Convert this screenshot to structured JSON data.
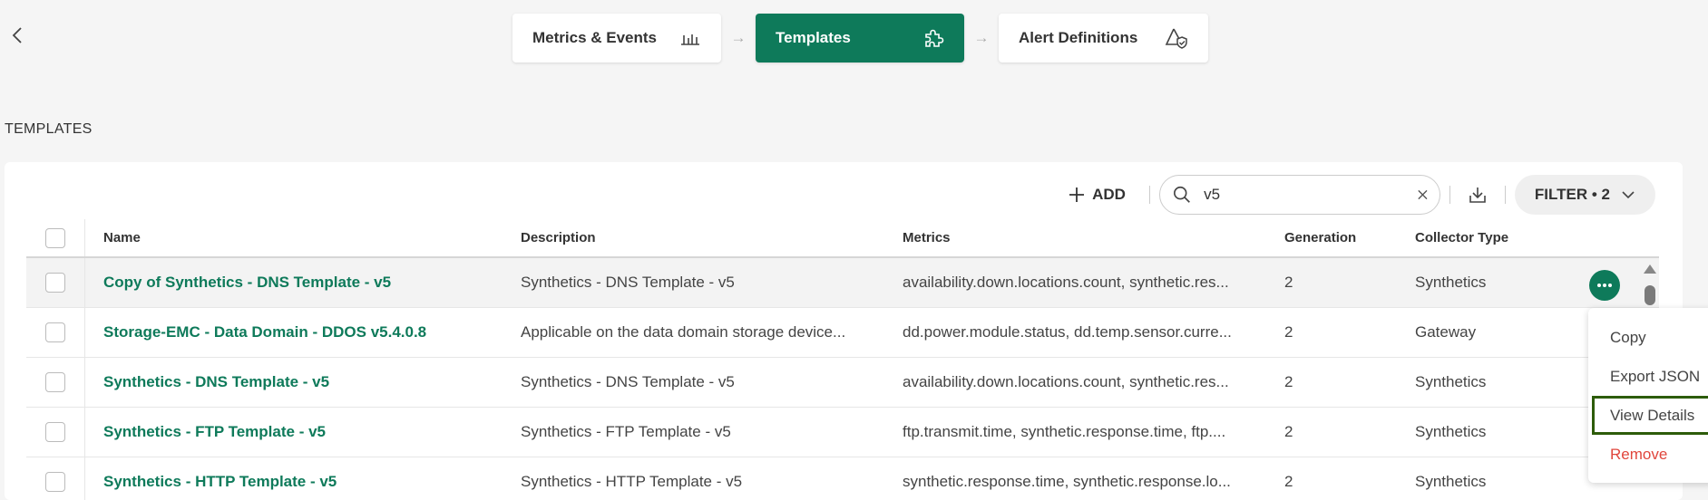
{
  "steps": [
    {
      "label": "Metrics & Events",
      "icon": "bar-chart-icon"
    },
    {
      "label": "Templates",
      "icon": "puzzle-icon"
    },
    {
      "label": "Alert Definitions",
      "icon": "alert-shield-icon"
    }
  ],
  "section_title": "TEMPLATES",
  "toolbar": {
    "add_label": "ADD",
    "search_value": "v5",
    "filter_label": "FILTER • 2"
  },
  "table": {
    "headers": {
      "name": "Name",
      "description": "Description",
      "metrics": "Metrics",
      "generation": "Generation",
      "collector_type": "Collector Type"
    },
    "rows": [
      {
        "name": "Copy of Synthetics - DNS Template - v5",
        "description": "Synthetics - DNS Template - v5",
        "metrics": "availability.down.locations.count, synthetic.res...",
        "generation": "2",
        "collector": "Synthetics"
      },
      {
        "name": "Storage-EMC - Data Domain - DDOS v5.4.0.8",
        "description": "Applicable on the data domain storage device...",
        "metrics": "dd.power.module.status, dd.temp.sensor.curre...",
        "generation": "2",
        "collector": "Gateway"
      },
      {
        "name": "Synthetics - DNS Template - v5",
        "description": "Synthetics - DNS Template - v5",
        "metrics": "availability.down.locations.count, synthetic.res...",
        "generation": "2",
        "collector": "Synthetics"
      },
      {
        "name": "Synthetics - FTP Template - v5",
        "description": "Synthetics - FTP Template - v5",
        "metrics": "ftp.transmit.time, synthetic.response.time, ftp....",
        "generation": "2",
        "collector": "Synthetics"
      },
      {
        "name": "Synthetics - HTTP Template - v5",
        "description": "Synthetics - HTTP Template - v5",
        "metrics": "synthetic.response.time, synthetic.response.lo...",
        "generation": "2",
        "collector": "Synthetics"
      }
    ]
  },
  "context_menu": {
    "items": [
      "Copy",
      "Export JSON",
      "View Details",
      "Remove"
    ]
  },
  "colors": {
    "brand": "#0e7a5a",
    "danger": "#e0463c",
    "highlight_outline": "#2d5c0a"
  }
}
